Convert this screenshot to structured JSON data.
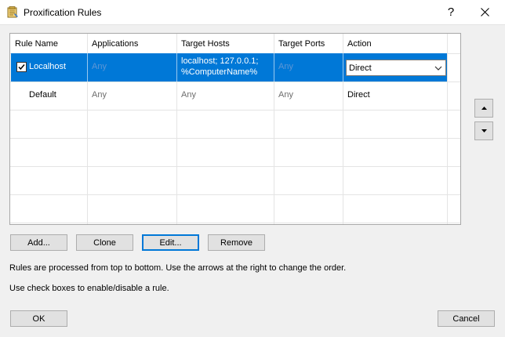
{
  "window": {
    "title": "Proxification Rules",
    "help_label": "?"
  },
  "grid": {
    "columns": [
      "Rule Name",
      "Applications",
      "Target Hosts",
      "Target Ports",
      "Action"
    ],
    "rows": [
      {
        "checked": true,
        "name": "Localhost",
        "applications": "Any",
        "target_hosts_line1": "localhost; 127.0.0.1;",
        "target_hosts_line2": "%ComputerName%",
        "target_ports": "Any",
        "action": "Direct"
      },
      {
        "checked": false,
        "name": "Default",
        "applications": "Any",
        "target_hosts_line1": "Any",
        "target_ports": "Any",
        "action": "Direct"
      }
    ]
  },
  "buttons": {
    "add": "Add...",
    "clone": "Clone",
    "edit": "Edit...",
    "remove": "Remove",
    "ok": "OK",
    "cancel": "Cancel"
  },
  "info": {
    "line1": "Rules are processed from top to bottom. Use the arrows at the right to change the order.",
    "line2": "Use check boxes to enable/disable a rule."
  },
  "colors": {
    "selection": "#0078d7",
    "disabled_text": "#8a8a8a"
  },
  "icons": [
    "app-icon",
    "help-icon",
    "close-icon",
    "checkbox-checked-icon",
    "chevron-down-icon",
    "arrow-up-icon",
    "arrow-down-icon"
  ]
}
